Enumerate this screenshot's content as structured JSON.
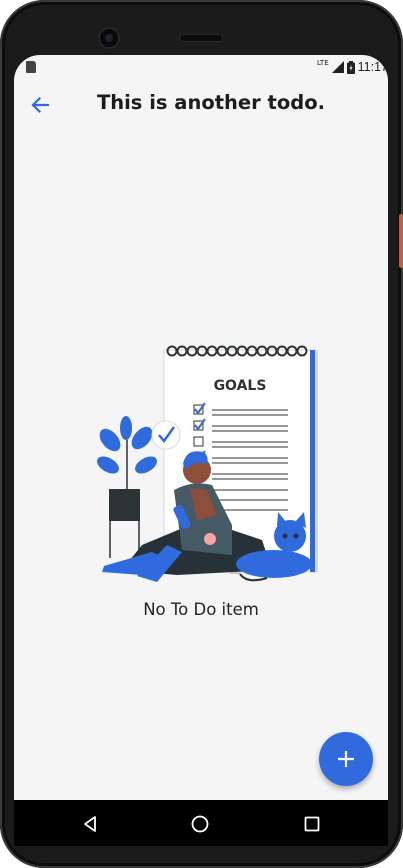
{
  "status_bar": {
    "network_label": "LTE",
    "time": "11:17",
    "icons": [
      "sd-card-icon",
      "signal-icon",
      "battery-icon"
    ]
  },
  "app_bar": {
    "back_icon": "arrow-back-icon",
    "title": "This is another todo."
  },
  "empty_state": {
    "illustration_label": "GOALS",
    "message": "No To Do item"
  },
  "fab": {
    "icon": "plus-icon"
  },
  "nav_bar": {
    "icons": [
      "back-triangle-icon",
      "home-circle-icon",
      "recents-square-icon"
    ]
  },
  "colors": {
    "accent": "#2f6bdc",
    "background": "#f4f5f4",
    "title_text": "#1d1d1d"
  }
}
